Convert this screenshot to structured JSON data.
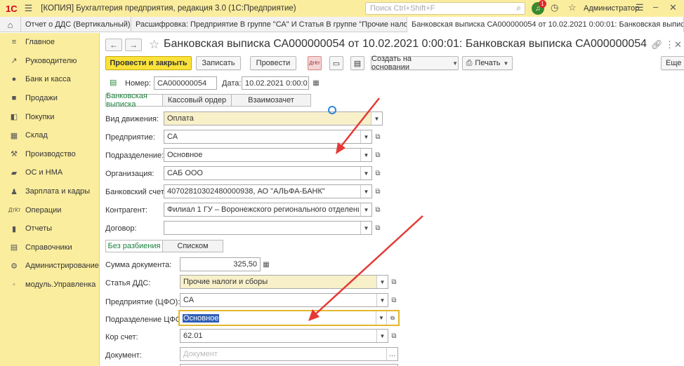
{
  "titlebar": {
    "logo": "1С",
    "title": "[КОПИЯ] Бухгалтерия предприятия, редакция 3.0  (1С:Предприятие)",
    "search_placeholder": "Поиск Ctrl+Shift+F",
    "notification_count": "1",
    "user": "Администратор"
  },
  "tabs": [
    {
      "label": "Отчет о ДДС (Вертикальный)"
    },
    {
      "label": "Расшифровка: Предприятие В группе \"СА\" И Статья В группе \"Прочие налоги..."
    },
    {
      "label": "Банковская выписка СА000000054 от 10.02.2021 0:00:01: Банковская выписка С..."
    }
  ],
  "sidebar": {
    "items": [
      {
        "label": "Главное",
        "icon": "menu-icon"
      },
      {
        "label": "Руководителю",
        "icon": "trend-icon"
      },
      {
        "label": "Банк и касса",
        "icon": "coin-icon"
      },
      {
        "label": "Продажи",
        "icon": "cart-icon"
      },
      {
        "label": "Покупки",
        "icon": "basket-icon"
      },
      {
        "label": "Склад",
        "icon": "grid-icon"
      },
      {
        "label": "Производство",
        "icon": "factory-icon"
      },
      {
        "label": "ОС и НМА",
        "icon": "truck-icon"
      },
      {
        "label": "Зарплата и кадры",
        "icon": "person-icon"
      },
      {
        "label": "Операции",
        "icon": "dt-kt-icon"
      },
      {
        "label": "Отчеты",
        "icon": "chart-icon"
      },
      {
        "label": "Справочники",
        "icon": "book-icon"
      },
      {
        "label": "Администрирование",
        "icon": "gear-icon"
      },
      {
        "label": "модуль.Управленка",
        "icon": "module-icon"
      }
    ]
  },
  "document": {
    "title": "Банковская выписка СА000000054 от 10.02.2021 0:00:01: Банковская выписка СА000000054 от 10...",
    "toolbar": {
      "post_close": "Провести и закрыть",
      "save": "Записать",
      "post": "Провести",
      "create_based": "Создать на основании",
      "print": "Печать",
      "more": "Еще"
    },
    "number_label": "Номер:",
    "number": "СА000000054",
    "date_label": "Дата:",
    "date": "10.02.2021  0:00:01",
    "top_tabs": [
      "Банковская выписка",
      "Кассовый ордер",
      "Взаимозачет"
    ],
    "fields": [
      {
        "label": "Вид движения:",
        "value": "Оплата"
      },
      {
        "label": "Предприятие:",
        "value": "СА"
      },
      {
        "label": "Подразделение:",
        "value": "Основное"
      },
      {
        "label": "Организация:",
        "value": "САБ ООО"
      },
      {
        "label": "Банковский счет:",
        "value": "40702810302480000938, АО \"АЛЬФА-БАНК\""
      },
      {
        "label": "Контрагент:",
        "value": "Филиал 1 ГУ – Воронежского регионального отделения ФСС"
      },
      {
        "label": "Договор:",
        "value": ""
      }
    ],
    "split_tabs": [
      "Без разбиения",
      "Списком"
    ],
    "amount_label": "Сумма документа:",
    "amount": "325,50",
    "dds_label": "Статья ДДС:",
    "dds": "Прочие налоги и сборы",
    "cfo_enterprise_label": "Предприятие (ЦФО):",
    "cfo_enterprise": "СА",
    "cfo_division_label": "Подразделение ЦФО:",
    "cfo_division": "Основное",
    "account_label": "Кор счет:",
    "account": "62.01",
    "doc_label": "Документ:",
    "doc_placeholder": "Документ"
  }
}
